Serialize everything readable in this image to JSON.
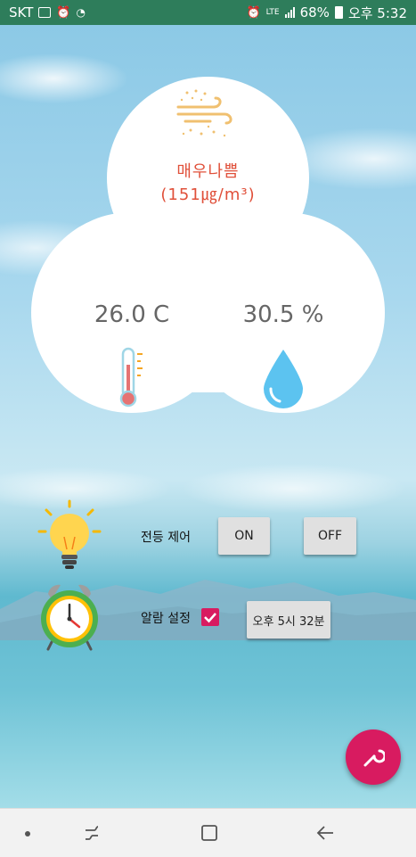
{
  "status_bar": {
    "carrier": "SKT",
    "network": "LTE",
    "battery": "68%",
    "time": "오후 5:32"
  },
  "air_quality": {
    "status": "매우나쁨",
    "value": "(151㎍/m³)"
  },
  "temperature": {
    "value": "26.0 C"
  },
  "humidity": {
    "value": "30.5 %"
  },
  "light_control": {
    "label": "전등 제어",
    "on_label": "ON",
    "off_label": "OFF"
  },
  "alarm": {
    "label": "알람 설정",
    "checked": true,
    "time_label": "오후 5시 32분"
  },
  "colors": {
    "accent": "#d81b60",
    "aq_text": "#e0503a",
    "status_bar": "#2e7d5b"
  }
}
